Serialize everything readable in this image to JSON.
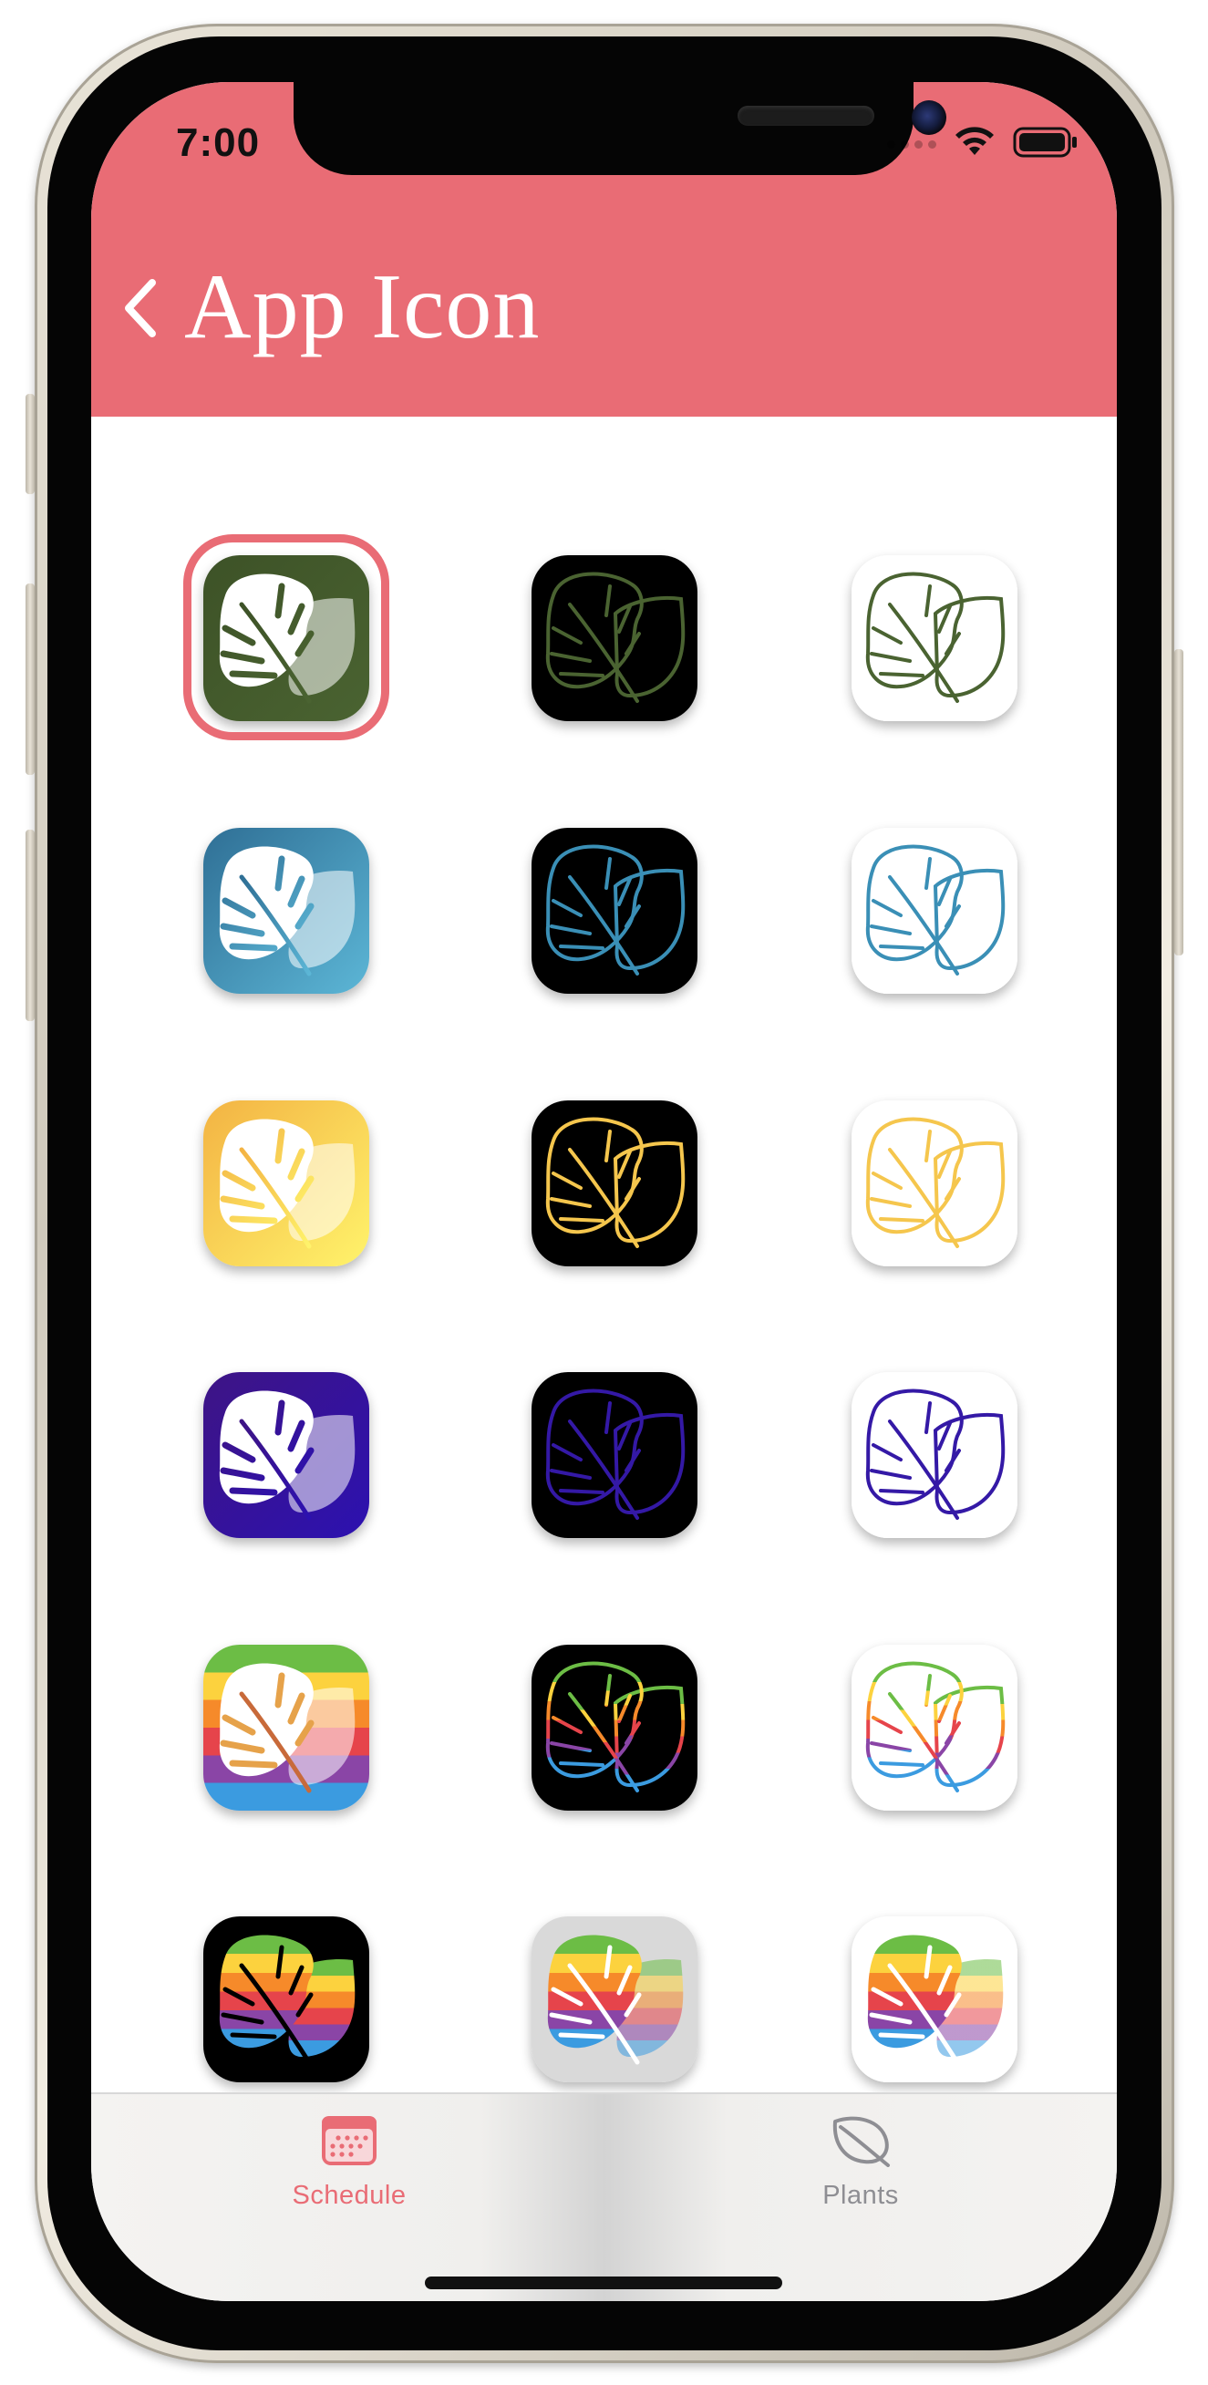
{
  "status_bar": {
    "time": "7:00",
    "wifi_icon": "wifi-icon",
    "battery_icon": "battery-icon"
  },
  "header": {
    "back_icon": "chevron-left-icon",
    "title": "App Icon",
    "background_color": "#e96c75"
  },
  "icons": {
    "selected_index": 0,
    "items": [
      {
        "name": "app-icon-green",
        "style": "solid",
        "background": "green"
      },
      {
        "name": "app-icon-green-dark",
        "style": "outline",
        "background": "black"
      },
      {
        "name": "app-icon-green-light",
        "style": "outline",
        "background": "white"
      },
      {
        "name": "app-icon-blue",
        "style": "solid",
        "background": "blue"
      },
      {
        "name": "app-icon-blue-dark",
        "style": "outline",
        "background": "black"
      },
      {
        "name": "app-icon-blue-light",
        "style": "outline",
        "background": "white"
      },
      {
        "name": "app-icon-yellow",
        "style": "solid",
        "background": "yellow"
      },
      {
        "name": "app-icon-yellow-dark",
        "style": "outline",
        "background": "black"
      },
      {
        "name": "app-icon-yellow-light",
        "style": "outline",
        "background": "white"
      },
      {
        "name": "app-icon-purple",
        "style": "solid",
        "background": "purple"
      },
      {
        "name": "app-icon-purple-dark",
        "style": "outline",
        "background": "black"
      },
      {
        "name": "app-icon-purple-light",
        "style": "outline",
        "background": "white"
      },
      {
        "name": "app-icon-rainbow",
        "style": "solid",
        "background": "rainbow"
      },
      {
        "name": "app-icon-rainbow-dark",
        "style": "outline",
        "background": "black"
      },
      {
        "name": "app-icon-rainbow-light",
        "style": "outline",
        "background": "white"
      },
      {
        "name": "app-icon-rainbow-fill-dark",
        "style": "fill",
        "background": "black"
      },
      {
        "name": "app-icon-rainbow-fill-gray",
        "style": "fill",
        "background": "gray"
      },
      {
        "name": "app-icon-rainbow-fill-light",
        "style": "fill",
        "background": "white"
      }
    ]
  },
  "tabbar": {
    "tabs": [
      {
        "label": "Schedule",
        "icon": "calendar-icon",
        "active": true
      },
      {
        "label": "Plants",
        "icon": "leaf-icon",
        "active": false
      }
    ],
    "active_color": "#e96c75",
    "inactive_color": "#8e8e93"
  }
}
